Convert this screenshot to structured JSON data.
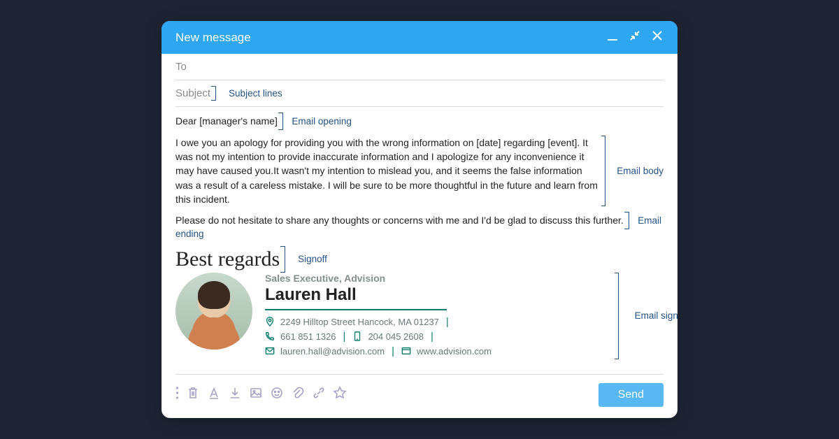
{
  "window": {
    "title": "New message"
  },
  "fields": {
    "to_placeholder": "To",
    "subject_placeholder": "Subject"
  },
  "annotations": {
    "subject": "Subject lines",
    "opening": "Email opening",
    "body": "Email body",
    "ending": "Email ending",
    "signoff": "Signoff",
    "signature": "Email signature/footer"
  },
  "email": {
    "greeting": "Dear [manager's name]",
    "body": "I owe you an apology for providing you with the wrong information on [date] regarding [event]. It was not my intention to provide inaccurate information and I apologize for any inconvenience it may have caused you.It wasn't my intention to mislead you, and it seems the false information was a result of a careless mistake. I will be sure to be more thoughtful in the future and learn from this incident.",
    "closing_line": "Please do not hesitate to share any thoughts or concerns with me and I'd be glad to discuss this further.",
    "signoff": "Best regards"
  },
  "signature": {
    "title": "Sales Executive, Advision",
    "name": "Lauren Hall",
    "address": "2249 Hilltop Street Hancock, MA 01237",
    "phone1": "661 851 1326",
    "phone2": "204 045 2608",
    "email": "lauren.hall@advision.com",
    "website": "www.advision.com"
  },
  "actions": {
    "send": "Send"
  }
}
